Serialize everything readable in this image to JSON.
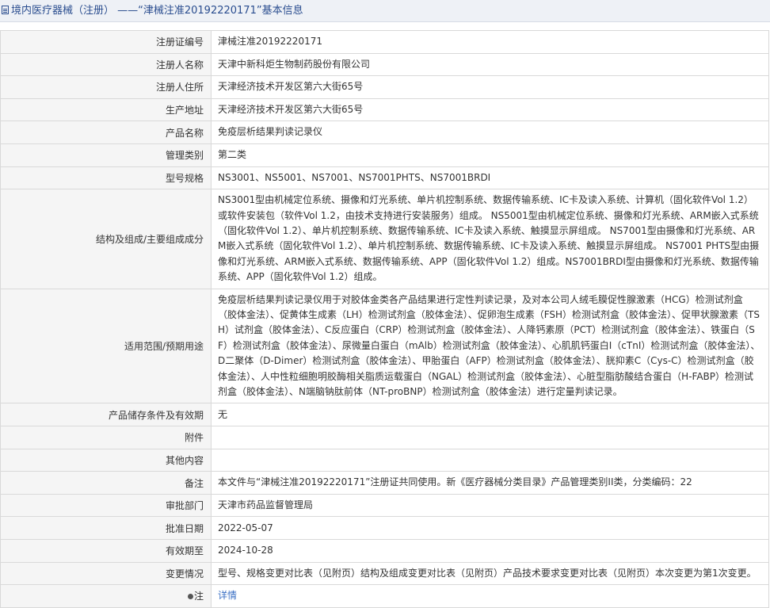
{
  "header": {
    "title": "境内医疗器械（注册） ——“津械注准20192220171”基本信息"
  },
  "rows": [
    {
      "label": "注册证编号",
      "value": "津械注准20192220171"
    },
    {
      "label": "注册人名称",
      "value": "天津中新科炬生物制药股份有限公司"
    },
    {
      "label": "注册人住所",
      "value": "天津经济技术开发区第六大街65号"
    },
    {
      "label": "生产地址",
      "value": "天津经济技术开发区第六大街65号"
    },
    {
      "label": "产品名称",
      "value": "免疫层析结果判读记录仪"
    },
    {
      "label": "管理类别",
      "value": "第二类"
    },
    {
      "label": "型号规格",
      "value": "NS3001、NS5001、NS7001、NS7001PHTS、NS7001BRDI"
    },
    {
      "label": "结构及组成/主要组成成分",
      "value": "NS3001型由机械定位系统、摄像和灯光系统、单片机控制系统、数据传输系统、IC卡及读入系统、计算机（固化软件Vol 1.2）或软件安装包（软件Vol 1.2，由技术支持进行安装服务）组成。 NS5001型由机械定位系统、摄像和灯光系统、ARM嵌入式系统（固化软件Vol 1.2）、单片机控制系统、数据传输系统、IC卡及读入系统、触摸显示屏组成。 NS7001型由摄像和灯光系统、ARM嵌入式系统（固化软件Vol 1.2）、单片机控制系统、数据传输系统、IC卡及读入系统、触摸显示屏组成。 NS7001 PHTS型由摄像和灯光系统、ARM嵌入式系统、数据传输系统、APP（固化软件Vol 1.2）组成。NS7001BRDI型由摄像和灯光系统、数据传输系统、APP（固化软件Vol 1.2）组成。"
    },
    {
      "label": "适用范围/预期用途",
      "value": "免疫层析结果判读记录仪用于对胶体金类各产品结果进行定性判读记录，及对本公司人绒毛膜促性腺激素（HCG）检测试剂盒（胶体金法）、促黄体生成素（LH）检测试剂盒（胶体金法）、促卵泡生成素（FSH）检测试剂盒（胶体金法）、促甲状腺激素（TSH）试剂盒（胶体金法）、C反应蛋白（CRP）检测试剂盒（胶体金法）、人降钙素原（PCT）检测试剂盒（胶体金法）、铁蛋白（SF）检测试剂盒（胶体金法）、尿微量白蛋白（mAlb）检测试剂盒（胶体金法）、心肌肌钙蛋白I（cTnI）检测试剂盒（胶体金法）、D二聚体（D-Dimer）检测试剂盒（胶体金法）、甲胎蛋白（AFP）检测试剂盒（胶体金法）、胱抑素C（Cys-C）检测试剂盒（胶体金法）、人中性粒细胞明胶酶相关脂质运载蛋白（NGAL）检测试剂盒（胶体金法）、心脏型脂肪酸结合蛋白（H-FABP）检测试剂盒（胶体金法）、N端脑钠肽前体（NT-proBNP）检测试剂盒（胶体金法）进行定量判读记录。"
    },
    {
      "label": "产品储存条件及有效期",
      "value": "无"
    },
    {
      "label": "附件",
      "value": ""
    },
    {
      "label": "其他内容",
      "value": ""
    },
    {
      "label": "备注",
      "value": "本文件与“津械注准20192220171”注册证共同使用。新《医疗器械分类目录》产品管理类别II类，分类编码：22"
    },
    {
      "label": "审批部门",
      "value": "天津市药品监督管理局"
    },
    {
      "label": "批准日期",
      "value": "2022-05-07"
    },
    {
      "label": "有效期至",
      "value": "2024-10-28"
    },
    {
      "label": "变更情况",
      "value": "型号、规格变更对比表（见附页）结构及组成变更对比表（见附页）产品技术要求变更对比表（见附页）本次变更为第1次变更。"
    }
  ],
  "note": {
    "label": "注",
    "icon": "info-dot-icon",
    "link_text": "详情"
  }
}
